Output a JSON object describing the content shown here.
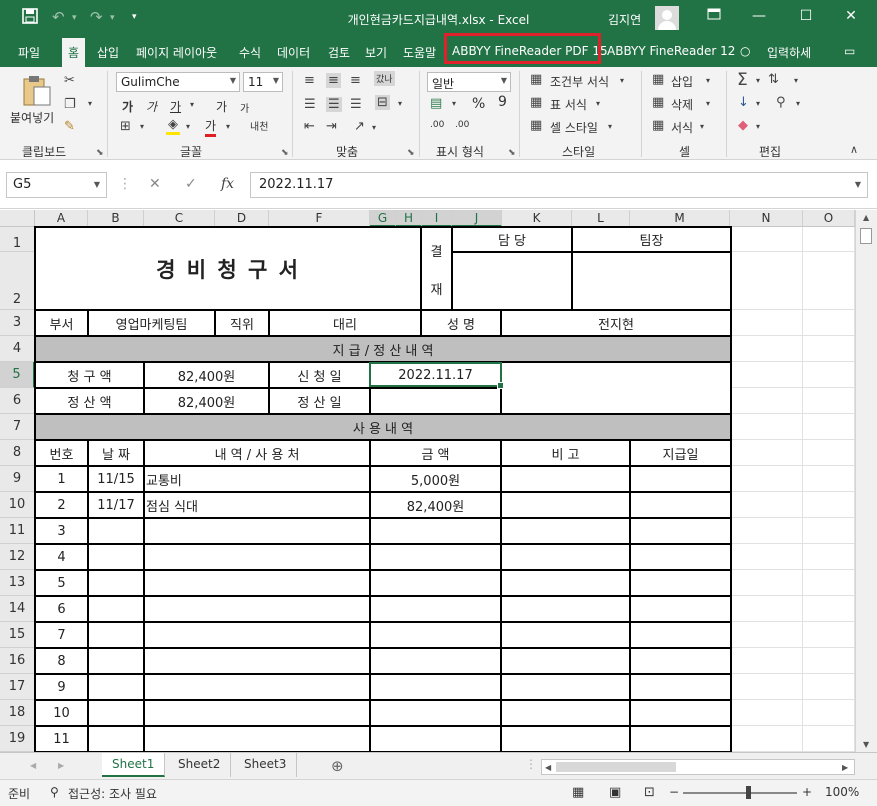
{
  "titlebar": {
    "filename": "개인현금카드지급내역.xlsx  -  Excel",
    "user": "김지연",
    "icons": [
      "save-icon",
      "undo-icon",
      "redo-icon",
      "qat-customize-icon",
      "ribbon-display-icon",
      "minimize-icon",
      "maximize-icon",
      "close-icon"
    ]
  },
  "tabs": [
    "파일",
    "홈",
    "삽입",
    "페이지 레이아웃",
    "수식",
    "데이터",
    "검토",
    "보기",
    "도움말",
    "ABBYY FineReader PDF 15",
    "ABBYY FineReader 12",
    "입력하세"
  ],
  "ribbon": {
    "clipboard": {
      "paste": "붙여넣기",
      "group": "클립보드"
    },
    "font": {
      "name": "GulimChe",
      "size": "11",
      "bold": "가",
      "italic": "가",
      "underline": "가",
      "grow": "가",
      "shrink": "가",
      "phonetic": "내천",
      "group": "글꼴"
    },
    "alignment": {
      "wrap": "갔나",
      "group": "맞춤"
    },
    "number": {
      "format": "일반",
      "percent": "%",
      "comma": "9",
      "inc_dec": ".00",
      "dec_dec": ".00",
      "group": "표시 형식"
    },
    "styles": {
      "conditional": "조건부 서식",
      "table": "표 서식",
      "cell": "셀 스타일",
      "group": "스타일"
    },
    "cells": {
      "insert": "삽입",
      "delete": "삭제",
      "format": "서식",
      "group": "셀"
    },
    "editing": {
      "group": "편집"
    }
  },
  "formula_bar": {
    "name_box": "G5",
    "fx": "fx",
    "value": "2022.11.17"
  },
  "columns": [
    "A",
    "B",
    "C",
    "D",
    "F",
    "G",
    "H",
    "I",
    "J",
    "K",
    "L",
    "M",
    "N",
    "O"
  ],
  "rows": [
    "1",
    "2",
    "3",
    "4",
    "5",
    "6",
    "7",
    "8",
    "9",
    "10",
    "11",
    "12",
    "13",
    "14",
    "15",
    "16",
    "17",
    "18",
    "19"
  ],
  "sheet": {
    "title": "경 비 청 구 서",
    "approval_label_1": "결",
    "approval_label_2": "재",
    "approval_manager": "담    당",
    "approval_lead": "팀장",
    "dept_label": "부서",
    "dept_value": "영업마케팅팀",
    "position_label": "직위",
    "position_value": "대리",
    "name_label": "성  명",
    "name_value": "전지현",
    "section_payment": "지 급 / 정 산 내 역",
    "claim_label": "청 구 액",
    "claim_value": "82,400원",
    "request_date_label": "신 청 일",
    "request_date_value": "2022.11.17",
    "settle_label": "정 산 액",
    "settle_value": "82,400원",
    "settle_date_label": "정 산 일",
    "section_usage": "사    용    내    역",
    "headers": [
      "번호",
      "날 짜",
      "내      역  /  사 용 처",
      "금      액",
      "비      고",
      "지급일"
    ],
    "items": [
      {
        "no": "1",
        "date": "11/15",
        "desc": "교통비",
        "amount": "5,000원"
      },
      {
        "no": "2",
        "date": "11/17",
        "desc": "점심 식대",
        "amount": "82,400원"
      },
      {
        "no": "3"
      },
      {
        "no": "4"
      },
      {
        "no": "5"
      },
      {
        "no": "6"
      },
      {
        "no": "7"
      },
      {
        "no": "8"
      },
      {
        "no": "9"
      },
      {
        "no": "10"
      },
      {
        "no": "11"
      }
    ]
  },
  "sheet_tabs": [
    "Sheet1",
    "Sheet2",
    "Sheet3"
  ],
  "status": {
    "ready": "준비",
    "accessibility": "접근성: 조사 필요",
    "zoom": "100%"
  }
}
